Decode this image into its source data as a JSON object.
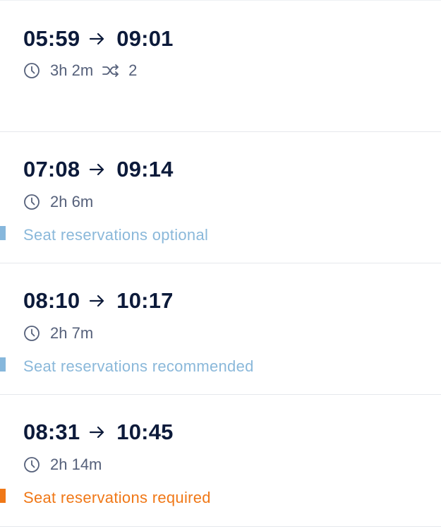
{
  "connections": [
    {
      "departure": "05:59",
      "arrival": "09:01",
      "duration": "3h 2m",
      "changes": "2",
      "reservation": ""
    },
    {
      "departure": "07:08",
      "arrival": "09:14",
      "duration": "2h 6m",
      "changes": "",
      "reservation": "Seat reservations optional",
      "reservation_color": "#8ab8da"
    },
    {
      "departure": "08:10",
      "arrival": "10:17",
      "duration": "2h 7m",
      "changes": "",
      "reservation": "Seat reservations recommended",
      "reservation_color": "#8ab8da"
    },
    {
      "departure": "08:31",
      "arrival": "10:45",
      "duration": "2h 14m",
      "changes": "",
      "reservation": "Seat reservations required",
      "reservation_color": "#f07817"
    }
  ],
  "icons": {
    "arrow": "arrow-right-icon",
    "clock": "clock-icon",
    "changes": "shuffle-icon"
  },
  "colors": {
    "time_text": "#0c1a3a",
    "meta_text": "#55607a",
    "info_blue": "#8ab8da",
    "required_orange": "#f07817"
  }
}
